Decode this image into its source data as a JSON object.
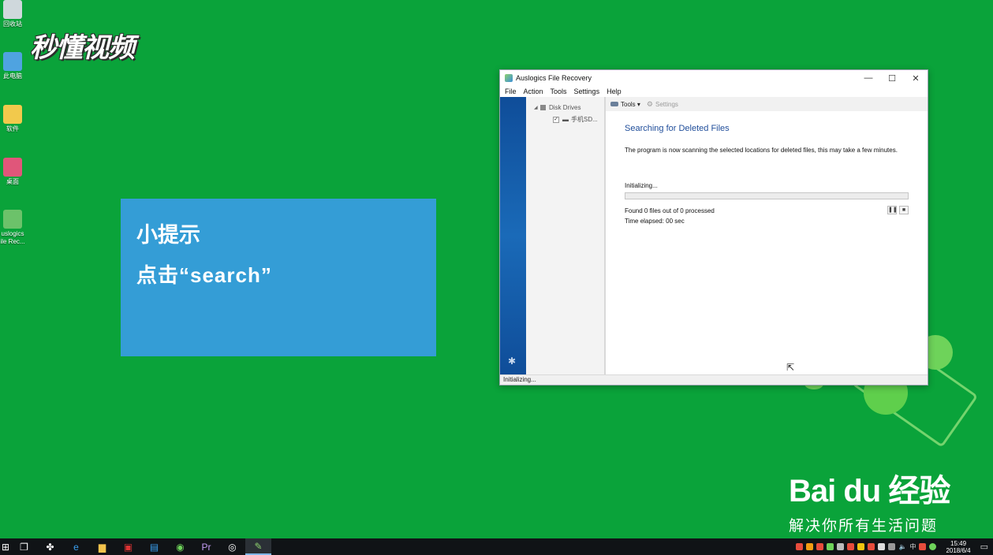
{
  "desktop": {
    "icons": [
      {
        "label": "回收站",
        "color": "#cfd8dc"
      },
      {
        "label": "此电脑",
        "color": "#4fa3e0"
      },
      {
        "label": "软件",
        "color": "#f2c94c"
      },
      {
        "label": "桌面",
        "color": "#e0567a"
      },
      {
        "label": "uslogics\nile Rec...",
        "line1": "uslogics",
        "line2": "ile Rec...",
        "color": "#6cc26a"
      }
    ]
  },
  "watermark": {
    "brand": "秒懂视频"
  },
  "tip": {
    "title": "小提示",
    "text": "点击“search”"
  },
  "baidu": {
    "logo": "Bai du 经验",
    "slogan": "解决你所有生活问题"
  },
  "window": {
    "title": "Auslogics File Recovery",
    "controls": {
      "minimize": "—",
      "maximize": "☐",
      "close": "✕"
    },
    "menu": [
      "File",
      "Action",
      "Tools",
      "Settings",
      "Help"
    ],
    "tree": {
      "root": "Disk Drives",
      "child": "手机SD..."
    },
    "toolbar": {
      "tools": "Tools ▾",
      "settings": "Settings"
    },
    "heading": "Searching for Deleted Files",
    "description": "The program is now scanning the selected locations for deleted files, this may take a few minutes.",
    "status_label": "Initializing...",
    "progress": 0,
    "found": "Found 0 files out of 0 processed",
    "elapsed": "Time elapsed: 00 sec",
    "statusbar": "Initializing..."
  },
  "taskbar": {
    "apps": [
      "start",
      "task-view",
      "fan",
      "edge",
      "explorer",
      "media",
      "store",
      "wechat",
      "premiere",
      "obs",
      "auslogics"
    ],
    "ime": "中",
    "time": "15:49",
    "date": "2018/6/4"
  }
}
